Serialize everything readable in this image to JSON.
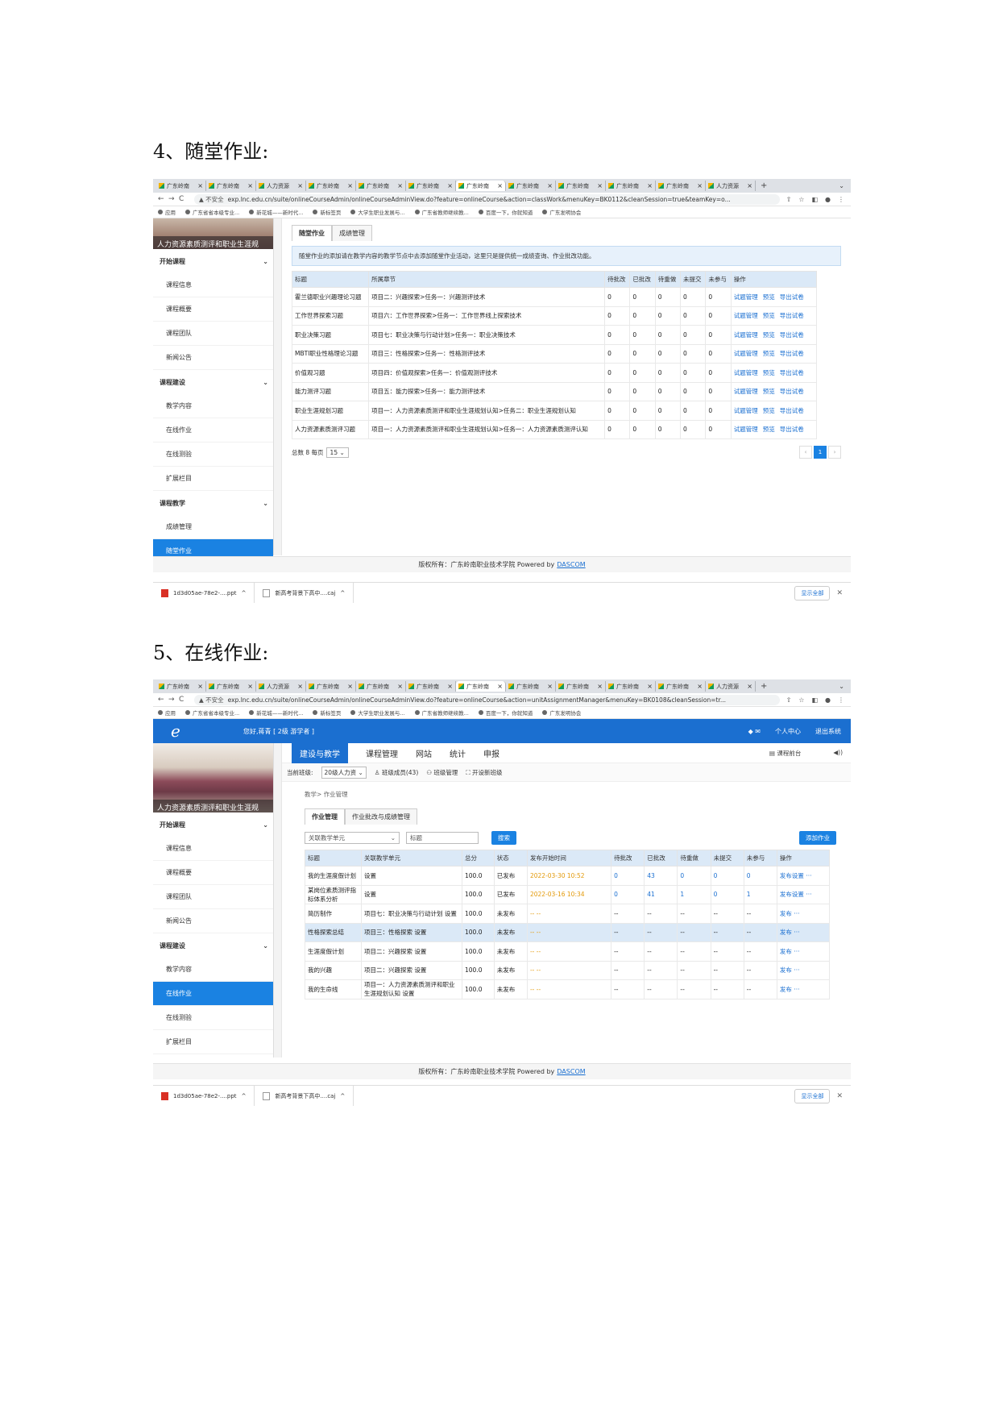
{
  "heading1": "4、随堂作业:",
  "heading2": "5、在线作业:",
  "browser": {
    "tabs": [
      "广东岭南",
      "广东岭南",
      "人力资源",
      "广东岭南",
      "广东岭南",
      "广东岭南",
      "广东岭南",
      "广东岭南",
      "广东岭南",
      "广东岭南",
      "广东岭南",
      "人力资源"
    ],
    "new_tab": "+",
    "tab_menu": "⌄",
    "insecure": "▲ 不安全",
    "url1": "exp.lnc.edu.cn/suite/onlineCourseAdmin/onlineCourseAdminView.do?feature=onlineCourse&action=classWork&menuKey=BK0112&cleanSession=true&teamKey=o...",
    "url2": "exp.lnc.edu.cn/suite/onlineCourseAdmin/onlineCourseAdminView.do?feature=onlineCourse&action=unitAssignmentManager&menuKey=BK0108&cleanSession=tr...",
    "bookmarks": [
      "应用",
      "广东省省本级专业...",
      "新花城——新时代...",
      "新标签页",
      "大学生职业发展与...",
      "广东省教师继续教...",
      "百度一下，你就知道",
      "广东发明协会"
    ]
  },
  "sidebar": {
    "course_title": "人力资源素质测评和职业生涯规",
    "groups": [
      {
        "label": "开始课程",
        "items": [
          "课程信息",
          "课程概要",
          "课程团队",
          "新闻公告"
        ]
      },
      {
        "label": "课程建设",
        "items": [
          "教学内容",
          "在线作业",
          "在线测验",
          "扩展栏目"
        ]
      },
      {
        "label": "课程教学",
        "items": [
          "成绩管理",
          "随堂作业"
        ]
      }
    ]
  },
  "shot1": {
    "subtabs": [
      "随堂作业",
      "成绩管理"
    ],
    "notice": "随堂作业的添加请在教学内容的教学节点中去添加随堂作业活动，这里只是提供统一成绩查询、作业批改功能。",
    "columns": [
      "标题",
      "所属章节",
      "待批改",
      "已批改",
      "待重做",
      "未提交",
      "未参与",
      "操作"
    ],
    "rows": [
      {
        "title": "霍兰德职业兴趣理论习题",
        "chapter": "项目二：兴趣探索>任务一：兴趣测评技术"
      },
      {
        "title": "工作世界探索习题",
        "chapter": "项目六：工作世界探索>任务一：工作世界线上探索技术"
      },
      {
        "title": "职业决策习题",
        "chapter": "项目七：职业决策与行动计划>任务一：职业决策技术"
      },
      {
        "title": "MBTI职业性格理论习题",
        "chapter": "项目三：性格探索>任务一：性格测评技术"
      },
      {
        "title": "价值观习题",
        "chapter": "项目四：价值观探索>任务一：价值观测评技术"
      },
      {
        "title": "能力测评习题",
        "chapter": "项目五：能力探索>任务一：能力测评技术"
      },
      {
        "title": "职业生涯规划习题",
        "chapter": "项目一：人力资源素质测评和职业生涯规划认知>任务二：职业生涯规划认知"
      },
      {
        "title": "人力资源素质测评习题",
        "chapter": "项目一：人力资源素质测评和职业生涯规划认知>任务一：人力资源素质测评认知"
      }
    ],
    "zero": "0",
    "actions": [
      "试题管理",
      "预览",
      "导出试卷"
    ],
    "total": "总数 8 每页",
    "page_size": "15",
    "page": "1"
  },
  "footer": {
    "copyright": "版权所有：广东岭南职业技术学院 Powered by",
    "brand": "DASCOM"
  },
  "downloads": {
    "file1": "1d3d05ae-78e2-....ppt",
    "file2": "新高考背景下高中....caj",
    "show_all": "显示全部",
    "close": "✕"
  },
  "shot2": {
    "logo": "e",
    "hello": "您好,蒋青 [ 2级 游学者 ]",
    "header_right": [
      "个人中心",
      "退出系统"
    ],
    "menus": [
      "建设与教学",
      "课程管理",
      "网站",
      "统计",
      "申报"
    ],
    "menu_right": "课程前台",
    "class_label": "当前班级:",
    "class_value": "20级人力资",
    "class_links": [
      "班级成员(43)",
      "班级管理",
      "开设新班级"
    ],
    "breadcrumb": "教学> 作业管理",
    "subtabs": [
      "作业管理",
      "作业批改与成绩管理"
    ],
    "unit_select": "关联教学单元",
    "search_placeholder": "标题",
    "search_button": "搜索",
    "add_button": "添加作业",
    "columns": [
      "标题",
      "关联教学单元",
      "总分",
      "状态",
      "发布开始时间",
      "待批改",
      "已批改",
      "待重做",
      "未提交",
      "未参与",
      "操作"
    ],
    "rows": [
      {
        "title": "我的生涯度假计划",
        "unit": "设置",
        "score": "100.0",
        "status": "已发布",
        "time": "2022-03-30 10:52",
        "c1": "0",
        "c2": "43",
        "c3": "0",
        "c4": "0",
        "c5": "0",
        "op": "发布设置 ···"
      },
      {
        "title": "某岗位素质测评指标体系分析",
        "unit": "设置",
        "score": "100.0",
        "status": "已发布",
        "time": "2022-03-16 10:34",
        "c1": "0",
        "c2": "41",
        "c3": "1",
        "c4": "0",
        "c5": "1",
        "op": "发布设置 ···"
      },
      {
        "title": "简历制作",
        "unit": "项目七：职业决策与行动计划 设置",
        "score": "100.0",
        "status": "未发布",
        "time": "-- --",
        "c1": "--",
        "c2": "--",
        "c3": "--",
        "c4": "--",
        "c5": "--",
        "op": "发布 ···"
      },
      {
        "title": "性格探索总结",
        "unit": "项目三：性格探索 设置",
        "score": "100.0",
        "status": "未发布",
        "time": "-- --",
        "c1": "--",
        "c2": "--",
        "c3": "--",
        "c4": "--",
        "c5": "--",
        "op": "发布 ···"
      },
      {
        "title": "生涯度假计划",
        "unit": "项目二：兴趣探索 设置",
        "score": "100.0",
        "status": "未发布",
        "time": "-- --",
        "c1": "--",
        "c2": "--",
        "c3": "--",
        "c4": "--",
        "c5": "--",
        "op": "发布 ···"
      },
      {
        "title": "我的兴趣",
        "unit": "项目二：兴趣探索 设置",
        "score": "100.0",
        "status": "未发布",
        "time": "-- --",
        "c1": "--",
        "c2": "--",
        "c3": "--",
        "c4": "--",
        "c5": "--",
        "op": "发布 ···"
      },
      {
        "title": "我的生命线",
        "unit": "项目一：人力资源素质测评和职业生涯规划认知 设置",
        "score": "100.0",
        "status": "未发布",
        "time": "-- --",
        "c1": "--",
        "c2": "--",
        "c3": "--",
        "c4": "--",
        "c5": "--",
        "op": "发布 ···"
      }
    ]
  },
  "colors": {
    "primary": "#1a82e2",
    "header_blue": "#1b6fd0",
    "date_orange": "#e39a0b",
    "table_header": "#dbe9f7"
  }
}
